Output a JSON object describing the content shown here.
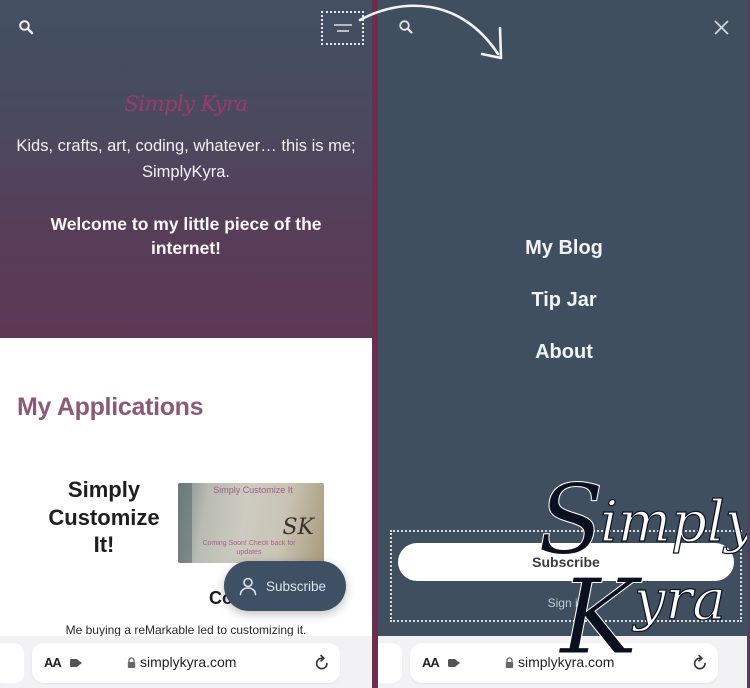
{
  "colors": {
    "hero_top": "#425062",
    "hero_bottom": "#5d3855",
    "menu_bg": "#404f5f",
    "divider": "#6a2e4f",
    "accent_heading": "#8a5a7a",
    "fab_bg": "#3e5064",
    "logo": "#9b3b6c"
  },
  "left_screen": {
    "header": {
      "search_icon": "search-icon",
      "menu_icon": "hamburger-menu-icon"
    },
    "hero": {
      "logo_text": "Simply Kyra",
      "tagline": "Kids, crafts, art, coding, whatever… this is me; SimplyKyra.",
      "welcome": "Welcome to my little piece of the internet!"
    },
    "applications": {
      "title": "My Applications",
      "app": {
        "name": "Simply Customize It!",
        "image_text": "Simply Customize It",
        "image_subtext": "Coming Soon! Check back for updates",
        "image_monogram": "SK",
        "subtitle": "Co",
        "description": "Me buying a reMarkable led to customizing it."
      }
    },
    "fab": {
      "icon": "person-icon",
      "label": "Subscribe"
    },
    "browser_bar": {
      "text_size_label": "AA",
      "extensions_icon": "extensions-icon",
      "lock_icon": "lock-icon",
      "url": "simplykyra.com",
      "reload_icon": "reload-icon"
    }
  },
  "right_screen": {
    "header": {
      "search_icon": "search-icon",
      "close_icon": "close-icon"
    },
    "menu": {
      "items": [
        {
          "label": "My Blog"
        },
        {
          "label": "Tip Jar"
        },
        {
          "label": "About"
        }
      ]
    },
    "subscribe": {
      "button_label": "Subscribe",
      "signin_label": "Sign in"
    },
    "browser_bar": {
      "text_size_label": "AA",
      "url": "simplykyra.com"
    }
  },
  "watermark": {
    "line1_initial": "S",
    "line1_rest": "imply",
    "line2_initial": "K",
    "line2_rest": "yra"
  }
}
